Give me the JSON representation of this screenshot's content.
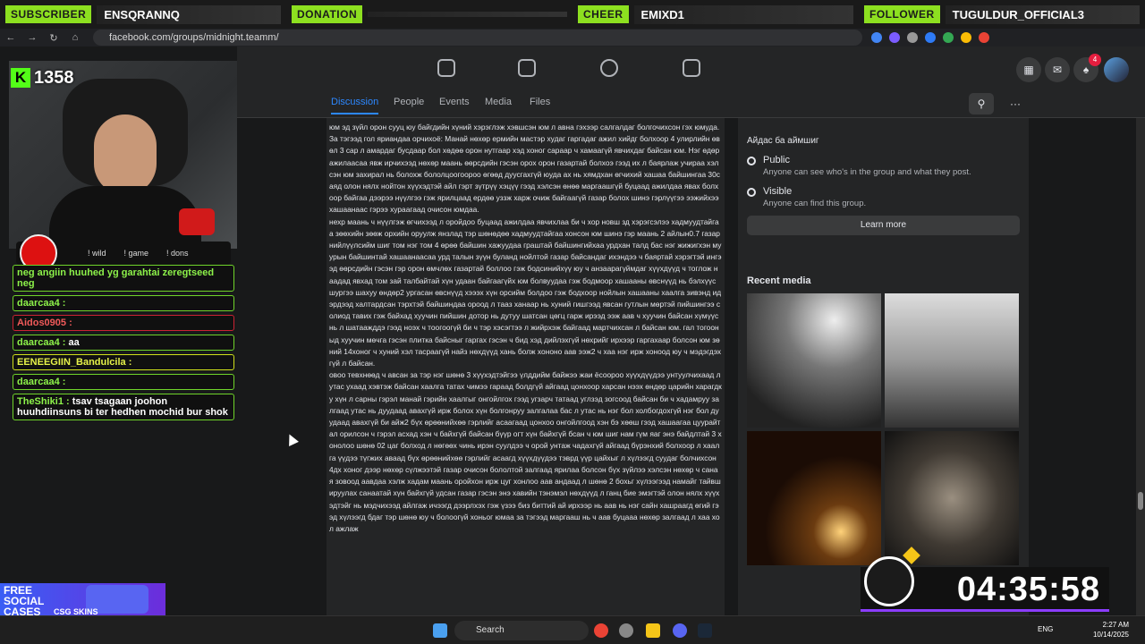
{
  "alerts": [
    {
      "label": "SUBSCRIBER",
      "name": "ENSQRANNQ"
    },
    {
      "label": "DONATION",
      "name": ""
    },
    {
      "label": "CHEER",
      "name": "EMIXD1"
    },
    {
      "label": "FOLLOWER",
      "name": "TUGULDUR_OFFICIAL3"
    }
  ],
  "browser": {
    "url": "facebook.com/groups/midnight.teamm/"
  },
  "fb": {
    "notif_count": "4",
    "tabs": [
      "Discussion",
      "People",
      "Events",
      "Media",
      "Files"
    ],
    "active_tab": "Discussion"
  },
  "post": {
    "paragraphs": [
      "юм эд зүйл орон сууц юу байгдийн хүний хэрэглэж хэвшсэн юм л авна гэхээр салгалдаг болгочихсон гэх юмуда. За тэгээд гол яриандаа орчихоё: Манай нөхөр ермийн мастэр худаг гаргадаг ажил хийдг болхоор 4 улирлийн өвөл 3 сар л амардаг бусдаар бол хөдөө орон нутгаар хэд хоног сараар ч хамаагүй явчихдаг байсан юм. Нэг өдөр ажилаасаа явж ирчихээд нөхөр маань өөрсдийн гэсэн орох орон газартай болхоэ гээд их л баярлаж учираа хэлсэн юм захирал нь болохж бололцоогоороо өгөөд дуусгахгүй юуда ах нь хямдхан өгчихий хашаа байшингаа 30саяд олон нялх нойтон хүүхэдтэй айл гэрт зүтрүү хэцүү гээд хэлсэн өнөө маргаашгүй буцаад ажилдаа явах болхоор байгаа дээрээ нүүлгээ гэж ярилцаад ердөө уззж харж очиж байгаагүй газар болох шинэ гэрлүүгээ ээжийхээ хашаанаас гэрээ хураагаад очисон юмдаа.",
      "нехр маань ч нүүлгэж өгчихээд л оройдоо буцаад ажилдаа явчихлаа би ч хор новш зд хэрэгсэлээ хадмуудтайгаа зөөхийн зөөж орхийн оруулж янзлад тэр шөнөдөө хадмуудтайгаа хонсон юм шинэ гэр маань 2 айлын0.7 газар нийлүүлсийм шиг том нэг том 4 өрөө байшин хажуудаа граштай байшингийхаа урдхан талд бас нэг жижигхэн муурын байшинтай хашаанаасаа урд талын зүүн буланд нойлтой газар байсандаг ихэндээ ч баяртай хэрэгтэй ингээд өөрсдийн гэсэн гэр орон өмчлөх газартай боллоо гэж бодсинийхүү юу ч анзаарагүймдаг хүүхдүүд ч тоглож наадад явхад том зай талбайтай хүн удаан байгаагүйх юм болвуудаа гэж бодмоор хашааны өвснүүд нь бэлхүүс шургээ шахуу өндөр2 ургасан өвснүүд хэээх хүн орсийм болдоо гэж бодхоор нойлын хашааны хаалга зивэнд идэрдээд халтардсан тэрхтэй байшиндаа ороод л тааз ханаар нь хуний гишгээд явсан гутлын мөртэй пийшингээ солиод тавих гэж байхад хуучин пийшин дотор нь дутуу шатсан цөгц гарж ирээд ээж аав ч хуучин байсан хүмүүс нь л шатаажддэ гээд ноэх ч тоогоогүй би ч тэр хэсэгтээ л жийрхэж байгаад мартчихсан л байсан юм. гал тогооныд хуучин мөчга гэсэн плитка байсныг гаргах гэсэн ч бид хэд дийлэхгүй нөхрийг ирхээр гаргахаар болсон юм зөний 14хоног ч хуний хэл тасраагүй найз нөхдүүд хань болж хононо аав ээж2 ч хаа нэг ирж хоноод юу ч мэдэгдэхгүй л байсан.",
      "овоо тевхнөөд ч авсан за тэр нэг шөнө 3 хүүхэдтэйгээ үлддийм байжээ жаи ёсоороо хүүхдүүдээ унтуулчихаад л утас ухаад хэвтэж байсан хаалга татах чимээ гараад болдгүй айгаад цонхоор харсан нээх өндөр царийн харагдку хүн л сарны гэрэл манай гэрийн хаалгыг онгойлгох гээд угзарч татаад углзэд зогсоод байсан би ч хадамруу залгаад утас нь дуудаад авахгүй ирж болох хүн болгонруу залгалаа бас л утас нь нэг бол холбогдохгүй нэг бол дуудаад авахгүй би айж2 бүх өрөөнийхөө гэрлийг асаагаад цонхоо онгойлгоод хэн бэ хөөш гээд хашаагаа цуурайтал орилсон ч гэрэл асхад хэн ч байхгүй байсан бүүр огт хүн байхгүй бсан ч юм шиг нам гүм яаг энэ байдлтай 3 хонолоо шөнө 02 цаг болход л нөгөөх чинь ирэн суулдээ ч орой унтаж чадахгүй айгаад бүрэнхий болхоор л хаалга үүдээ түгжих аваад бүх өрөөнийхөө гэрлийг асаагд хүүхдүүдээ тэврд үүр цайхыг л хүлээгд суудаг болчихсон 4дх хоног дээр нөхөр сүлжээтэй газар очисон бололтой залгаад ярилаа болсон бүх зүйлээ хэлсэн нөхөр ч саная зовоод аавдаа хэлж хадам маань оройхон ирж цуг хонлоо аав андаад л шөнө 2 бохьг хүлээгээд намайг тайвшируулах санаатай хүн байхгүй удсан газар гэсэн энэ хавийн тэнэмэл нөхдүүд л ганц бие эмэгтэй олон нялх хүүхэдтэйг нь мэдчихээд айлгаж ичээгд дээрлхэх гэж үзээ биз биттий ай ирхээр нь аав нь нэг сайн хашраагд өгий гээд хүлээгд бдаг тэр шөнө юу ч болоогүй хоньог юмаа за тэгээд маргааш нь ч аав буцааа нөхөр залгаад л хаа хол ажлаж"
    ]
  },
  "about": {
    "line": "Айдас ба аймшиг",
    "public_title": "Public",
    "public_desc": "Anyone can see who's in the group and what they post.",
    "visible_title": "Visible",
    "visible_desc": "Anyone can find this group.",
    "learn_more": "Learn more",
    "recent_media": "Recent media"
  },
  "stream": {
    "kick_count": "1358",
    "commands": [
      "! wild",
      "! game",
      "! dons"
    ],
    "chat": [
      {
        "user": "",
        "text": "neg angiin huuhed yg garahtai zeregtseed neg",
        "style": "green"
      },
      {
        "user": "daarcaa4 :",
        "text": "",
        "style": "green"
      },
      {
        "user": "Aidos0905 :",
        "text": "",
        "style": "red"
      },
      {
        "user": "daarcaa4 :",
        "text": "aa",
        "style": "green"
      },
      {
        "user": "EENEEGIIN_Bandulcila :",
        "text": "",
        "style": "yel"
      },
      {
        "user": "daarcaa4 :",
        "text": "",
        "style": "green"
      },
      {
        "user": "TheShiki1 :",
        "text": "tsav tsagaan joohon huuhdiinsuns bi ter hedhen mochid bur shok",
        "style": "green"
      }
    ],
    "promo_title": "FREE SOCIAL CASES",
    "promo_sub": "CSG SKINS",
    "timer": "04:35:58"
  },
  "taskbar": {
    "search_placeholder": "Search",
    "lang": "ENG",
    "time": "2:27 AM",
    "date": "10/14/2025"
  },
  "colors": {
    "accent": "#2d88ff",
    "kick": "#53fc18",
    "alert": "#8de020"
  }
}
